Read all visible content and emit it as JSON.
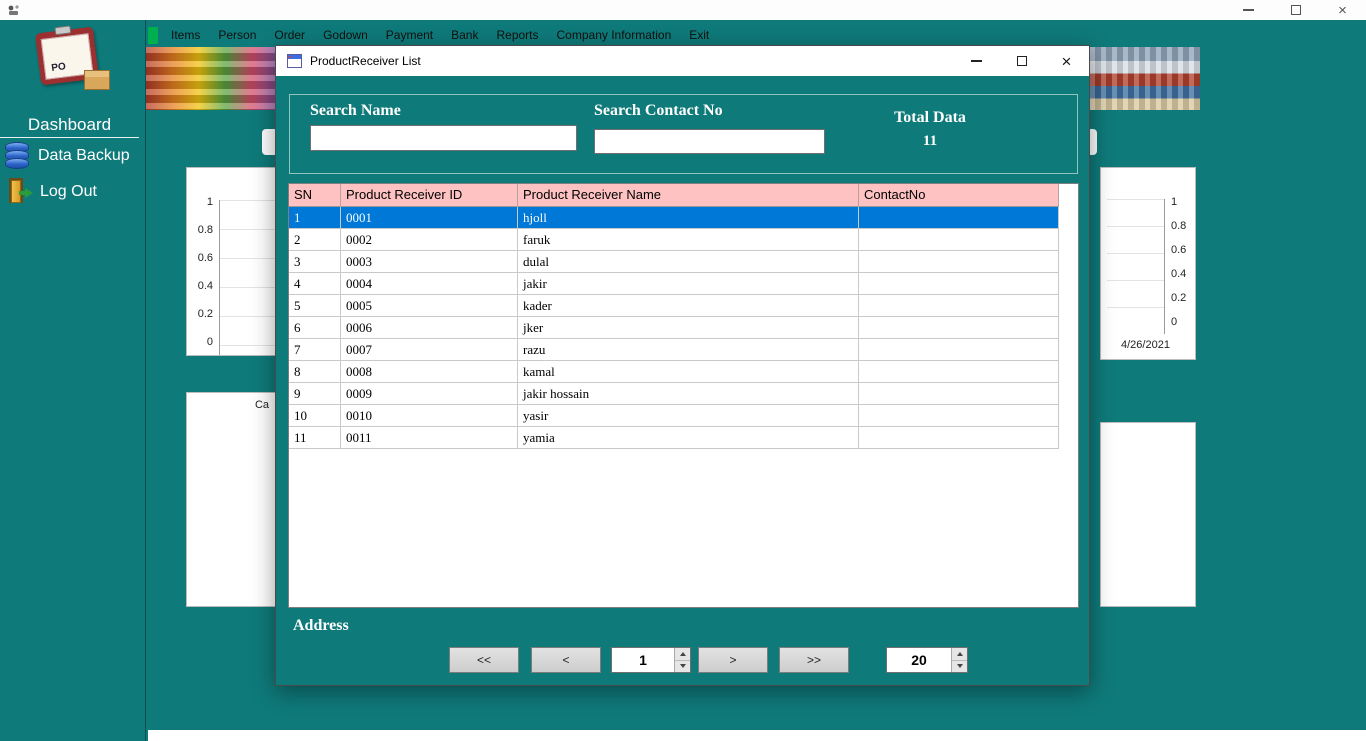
{
  "window": {
    "title": ""
  },
  "menubar": {
    "items": [
      "Items",
      "Person",
      "Order",
      "Godown",
      "Payment",
      "Bank",
      "Reports",
      "Company Information",
      "Exit"
    ]
  },
  "sidebar": {
    "logo_text": "PO",
    "dashboard_label": "Dashboard",
    "items": [
      {
        "icon": "database-icon",
        "label": "Data Backup"
      },
      {
        "icon": "logout-icon",
        "label": "Log Out"
      }
    ]
  },
  "charts": {
    "left_ticks": [
      "1",
      "0.8",
      "0.6",
      "0.4",
      "0.2",
      "0"
    ],
    "right_ticks": [
      "1",
      "0.8",
      "0.6",
      "0.4",
      "0.2",
      "0"
    ],
    "right_date": "4/26/2021",
    "bottom_left_label": "Ca"
  },
  "dialog": {
    "title": "ProductReceiver List",
    "search_name_label": "Search Name",
    "search_name_value": "",
    "search_contact_label": "Search Contact No",
    "search_contact_value": "",
    "total_label": "Total Data",
    "total_value": "11",
    "address_label": "Address",
    "grid": {
      "columns": [
        "SN",
        "Product Receiver ID",
        "Product Receiver Name",
        "ContactNo"
      ],
      "selected_index": 0,
      "rows": [
        [
          "1",
          "0001",
          "hjoll",
          ""
        ],
        [
          "2",
          "0002",
          "faruk",
          ""
        ],
        [
          "3",
          "0003",
          "dulal",
          ""
        ],
        [
          "4",
          "0004",
          "jakir",
          ""
        ],
        [
          "5",
          "0005",
          "kader",
          ""
        ],
        [
          "6",
          "0006",
          "jker",
          ""
        ],
        [
          "7",
          "0007",
          "razu",
          ""
        ],
        [
          "8",
          "0008",
          "kamal",
          ""
        ],
        [
          "9",
          "0009",
          "jakir hossain",
          ""
        ],
        [
          "10",
          "0010",
          "yasir",
          ""
        ],
        [
          "11",
          "0011",
          "yamia",
          ""
        ]
      ]
    },
    "pager": {
      "first": "<<",
      "prev": "<",
      "page": "1",
      "next": ">",
      "last": ">>",
      "page_size": "20"
    }
  },
  "colors": {
    "teal": "#0f7a7a",
    "header_pink": "#ffc2c3",
    "selection_blue": "#0078d7"
  }
}
